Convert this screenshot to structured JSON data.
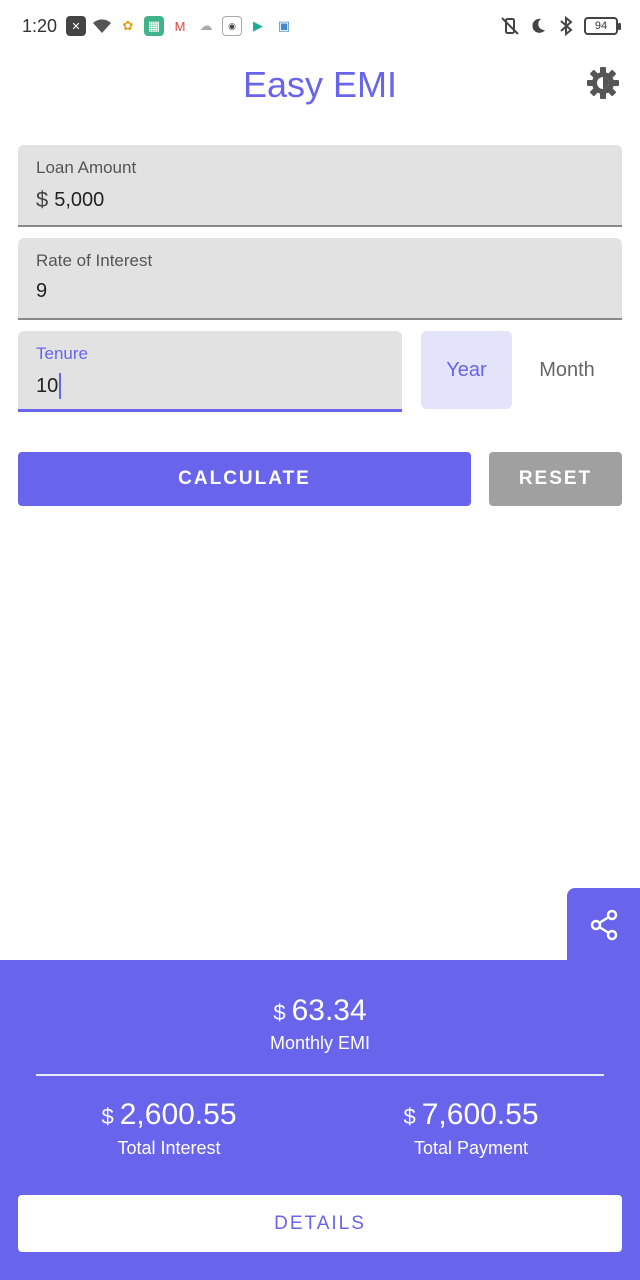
{
  "status_bar": {
    "time": "1:20",
    "battery": "94",
    "left_icons": [
      "close-notification-icon",
      "wifi-icon",
      "photos-icon",
      "app-icon",
      "gmail-icon",
      "cloud-icon",
      "news-icon",
      "play-store-icon",
      "app-icon"
    ],
    "right_icons": [
      "vibrate-off-icon",
      "moon-icon",
      "bluetooth-icon",
      "battery-icon"
    ]
  },
  "header": {
    "title": "Easy EMI"
  },
  "form": {
    "loan_amount": {
      "label": "Loan Amount",
      "prefix": "$",
      "value": "5,000"
    },
    "rate": {
      "label": "Rate of Interest",
      "value": "9"
    },
    "tenure": {
      "label": "Tenure",
      "value": "10"
    },
    "tenure_unit": {
      "options": [
        "Year",
        "Month"
      ],
      "selected": "Year"
    }
  },
  "actions": {
    "calculate": "CALCULATE",
    "reset": "RESET"
  },
  "result": {
    "currency": "$",
    "monthly_emi": {
      "value": "63.34",
      "label": "Monthly EMI"
    },
    "total_interest": {
      "value": "2,600.55",
      "label": "Total Interest"
    },
    "total_payment": {
      "value": "7,600.55",
      "label": "Total Payment"
    },
    "details_button": "DETAILS"
  },
  "colors": {
    "accent": "#6864ec",
    "field_bg": "#e2e2e2",
    "reset_bg": "#a0a0a0",
    "segment_selected_bg": "#e3e3fb"
  }
}
